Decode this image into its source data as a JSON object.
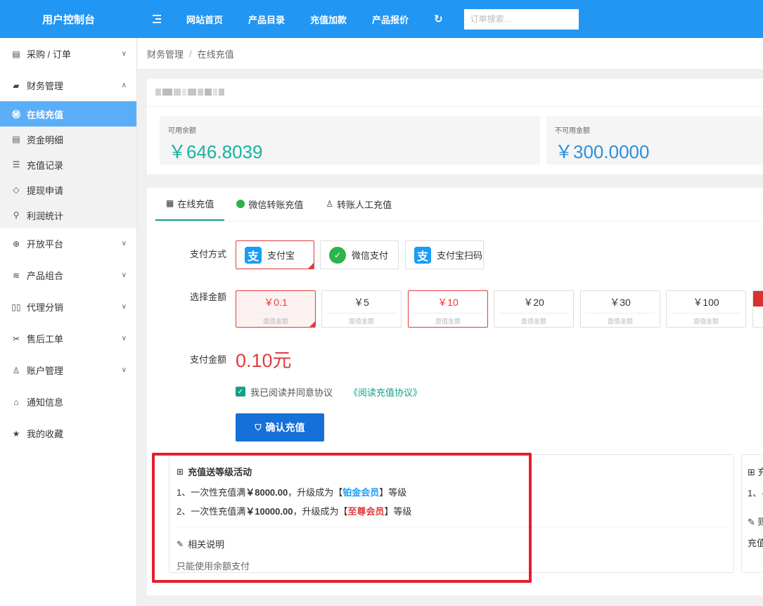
{
  "brand": "用户控制台",
  "topnav": {
    "items": [
      "网站首页",
      "产品目录",
      "充值加款",
      "产品报价"
    ],
    "search_placeholder": "订单搜索..."
  },
  "sidebar": {
    "items": [
      {
        "label": "采购 / 订单",
        "icon": "clipboard-icon",
        "chevron": "down"
      },
      {
        "label": "财务管理",
        "icon": "wallet-icon",
        "chevron": "up"
      }
    ],
    "sub_items": [
      {
        "label": "在线充值",
        "icon": "yen-icon",
        "active": true
      },
      {
        "label": "资金明细",
        "icon": "document-icon"
      },
      {
        "label": "充值记录",
        "icon": "list-icon"
      },
      {
        "label": "提现申请",
        "icon": "tag-icon"
      },
      {
        "label": "利润统计",
        "icon": "search-icon"
      }
    ],
    "items_after": [
      {
        "label": "开放平台",
        "icon": "globe-icon",
        "chevron": "down"
      },
      {
        "label": "产品组合",
        "icon": "layers-icon",
        "chevron": "down"
      },
      {
        "label": "代理分销",
        "icon": "columns-icon",
        "chevron": "down"
      },
      {
        "label": "售后工单",
        "icon": "tools-icon",
        "chevron": "down"
      },
      {
        "label": "账户管理",
        "icon": "user-icon",
        "chevron": "down"
      },
      {
        "label": "通知信息",
        "icon": "home-icon"
      },
      {
        "label": "我的收藏",
        "icon": "star-icon"
      }
    ]
  },
  "breadcrumb": {
    "parent": "财务管理",
    "separator": "/",
    "current": "在线充值"
  },
  "balance": {
    "available_label": "可用余额",
    "available_value": "￥646.8039",
    "unavailable_label": "不可用金额",
    "unavailable_value": "￥300.0000"
  },
  "tabs": [
    "在线充值",
    "微信转账充值",
    "转账人工充值"
  ],
  "payment": {
    "method_label": "支付方式",
    "methods": [
      "支付宝",
      "微信支付",
      "支付宝扫码"
    ],
    "amount_label": "选择金额",
    "amounts": [
      "￥0.1",
      "￥5",
      "￥10",
      "￥20",
      "￥30",
      "￥100"
    ],
    "amount_sub": "面值金额",
    "pay_amount_label": "支付金额",
    "pay_amount_value": "0.10元",
    "agree_text": "我已阅读并同意协议",
    "agree_link": "《阅读充值协议》",
    "confirm_label": "确认充值"
  },
  "promo": {
    "title": "充值送等级活动",
    "line1_prefix": "1、一次性充值满",
    "line1_amount": "￥8000.00",
    "line1_mid": "，升级成为【",
    "line1_level": "铂金会员",
    "line1_suffix": "】等级",
    "line2_prefix": "2、一次性充值满",
    "line2_amount": "￥10000.00",
    "line2_mid": "，升级成为【",
    "line2_level": "至尊会员",
    "line2_suffix": "】等级",
    "note_title": "相关说明",
    "note_text": "只能使用余额支付"
  },
  "promo_partial": {
    "line1": "充",
    "line2": "1、-",
    "line3": "则",
    "line4": "充值"
  },
  "colors": {
    "topbar": "#2196f3",
    "active_sub": "#5aaef8",
    "accent_green": "#16a085",
    "red": "#e43b3b",
    "confirm": "#1570d8"
  }
}
